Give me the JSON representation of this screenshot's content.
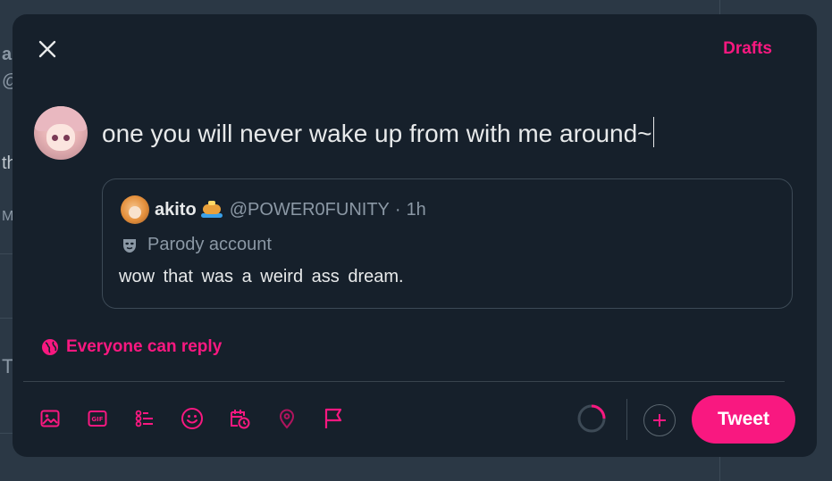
{
  "background": {
    "fragments": [
      "a",
      "@",
      "th",
      "M",
      "T"
    ]
  },
  "header": {
    "drafts_label": "Drafts"
  },
  "composer": {
    "text": "one you will never wake up from with me around~"
  },
  "quote": {
    "name": "akito",
    "handle": "@POWER0FUNITY",
    "separator": "·",
    "time": "1h",
    "label": "Parody account",
    "body": "wow that was a weird ass dream."
  },
  "reply_setting": {
    "label": "Everyone can reply"
  },
  "toolbar": {
    "icons": [
      "image-icon",
      "gif-icon",
      "poll-icon",
      "emoji-icon",
      "schedule-icon",
      "location-icon",
      "flag-icon"
    ]
  },
  "actions": {
    "tweet_label": "Tweet"
  },
  "colors": {
    "accent": "#f91880",
    "modal_bg": "#16202b",
    "backdrop": "#2b3845"
  }
}
